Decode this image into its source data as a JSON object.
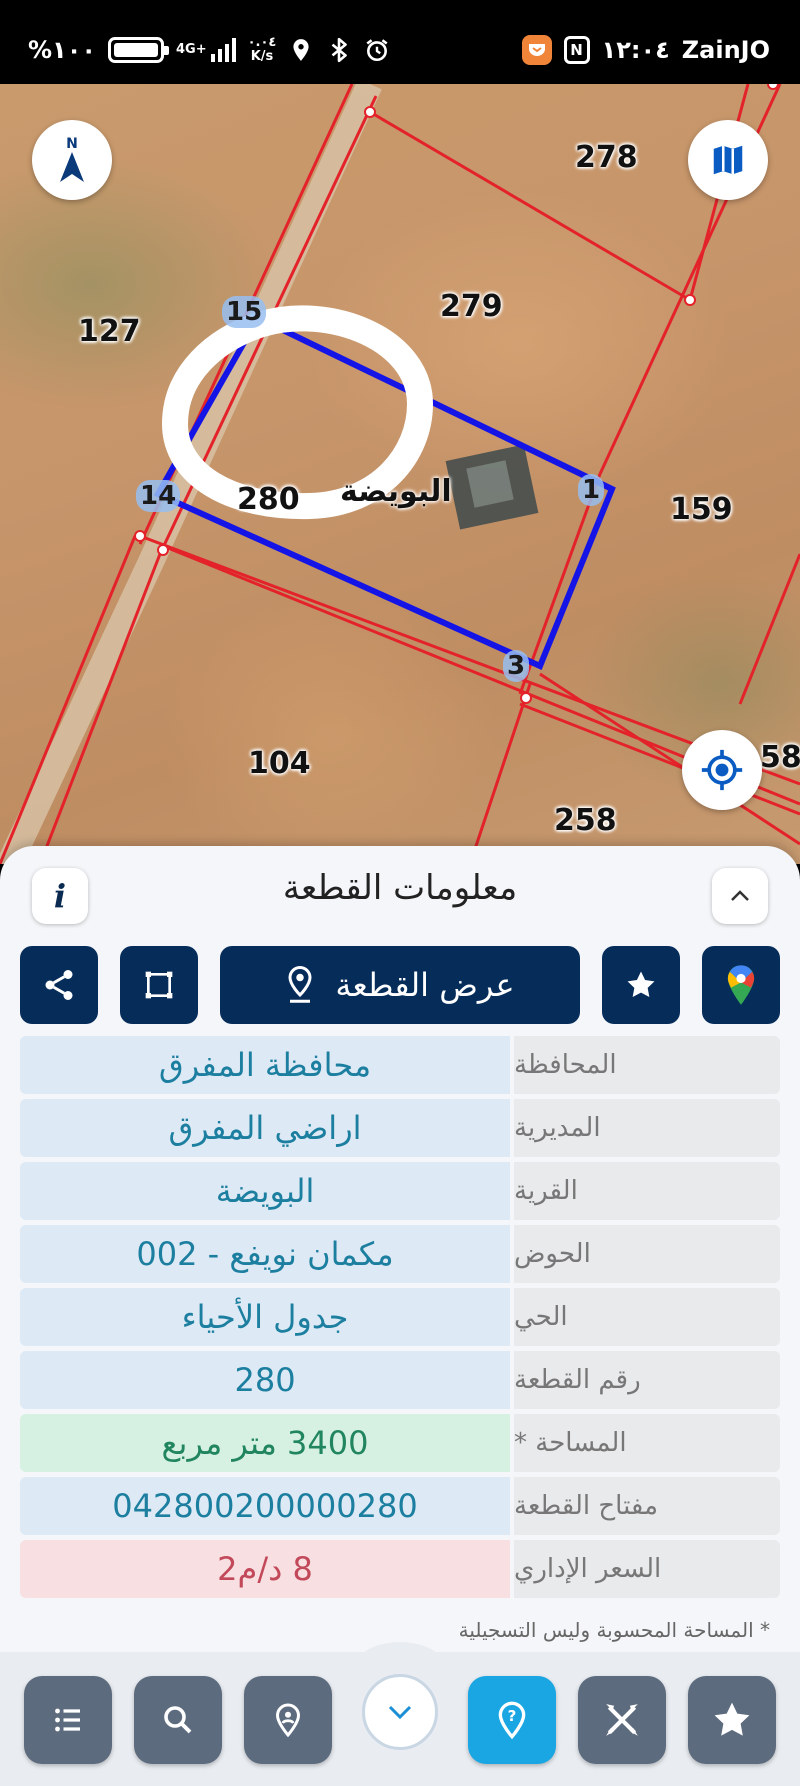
{
  "status_bar": {
    "battery_text": "%١٠٠",
    "battery_level": 1.0,
    "network_type": "4G+",
    "speed_value": "٠.٠٤",
    "speed_unit": "K/s",
    "time": "١٢:٠٤",
    "carrier": "ZainJO",
    "icons": [
      "location-icon",
      "bluetooth-icon",
      "alarm-icon",
      "app-badge-icon",
      "nfc-icon"
    ]
  },
  "map": {
    "parcels": [
      "278",
      "279",
      "127",
      "280",
      "159",
      "104",
      "258",
      "58"
    ],
    "vertices": [
      "15",
      "14",
      "1",
      "3"
    ],
    "village_label": "البويضة",
    "colors": {
      "parcel_line": "#e3222a",
      "selected_parcel": "#1414e6",
      "highlight_circle": "#ffffff"
    },
    "buttons": [
      "compass-north-icon",
      "map-layers-icon",
      "my-location-icon"
    ],
    "compass_letter": "N"
  },
  "panel": {
    "title": "معلومات القطعة",
    "actions": {
      "show_parcel_label": "عرض القطعة",
      "icons": [
        "share-icon",
        "polygon-icon",
        "location-pin-icon",
        "star-icon",
        "google-maps-icon"
      ]
    },
    "rows": [
      {
        "label": "المحافظة",
        "value": "محافظة المفرق"
      },
      {
        "label": "المديرية",
        "value": "اراضي المفرق"
      },
      {
        "label": "القرية",
        "value": "البويضة"
      },
      {
        "label": "الحوض",
        "value": "مكمان نويفع - 002"
      },
      {
        "label": "الحي",
        "value": "جدول الأحياء"
      },
      {
        "label": "رقم القطعة",
        "value": "280"
      },
      {
        "label": "المساحة *",
        "value": "3400  متر مربع"
      },
      {
        "label": "مفتاح القطعة",
        "value": "042800200000280"
      },
      {
        "label": "السعر الإداري",
        "value": "8 د/م2"
      }
    ],
    "footnote": "* المساحة المحسوبة وليس التسجيلية",
    "colors": {
      "primary": "#062c5a",
      "value_blue": "#1c7fa0",
      "value_green": "#21855f",
      "value_red": "#c2495a"
    }
  },
  "bottom_nav": {
    "items": [
      "list-icon",
      "search-icon",
      "pin-search-icon",
      "chevron-down-icon",
      "help-icon",
      "tools-icon",
      "star-icon"
    ],
    "active_item": "help-icon",
    "colors": {
      "button": "#5d6b7e",
      "active": "#19a6e3"
    }
  }
}
